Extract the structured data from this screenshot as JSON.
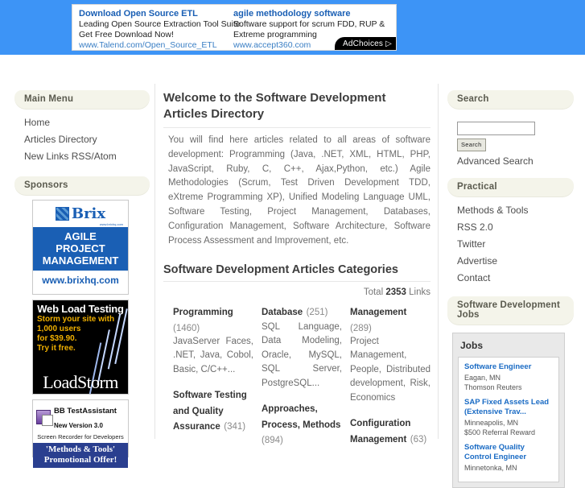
{
  "top_ad": {
    "left": {
      "title": "Download Open Source ETL",
      "line1": "Leading Open Source Extraction Tool Suite.",
      "line2": "Get Free Download Now!",
      "url": "www.Talend.com/Open_Source_ETL"
    },
    "right": {
      "title": "agile methodology software",
      "line1": "Software support for scrum FDD, RUP &",
      "line2": "Extreme programming",
      "url": "www.accept360.com"
    },
    "adchoices_label": "AdChoices"
  },
  "left_sidebar": {
    "main_menu": {
      "caption": "Main Menu",
      "items": [
        {
          "label": "Home"
        },
        {
          "label": "Articles Directory"
        },
        {
          "label": "New Links RSS/Atom"
        }
      ]
    },
    "sponsors": {
      "caption": "Sponsors",
      "banners": [
        {
          "name": "brix",
          "brand": "Brix",
          "site_small": "www.brixhq.com",
          "headline_line1": "AGILE",
          "headline_line2": "PROJECT",
          "headline_line3": "MANAGEMENT",
          "url": "www.brixhq.com"
        },
        {
          "name": "loadstorm",
          "title": "Web Load Testing",
          "line1": "Storm your site with",
          "line2": "1,000 users",
          "line3": "for $39.90.",
          "line4": "Try it free.",
          "logo": "LoadStorm"
        },
        {
          "name": "bb-testassistant",
          "title": "BB TestAssistant",
          "subtitle": "New Version 3.0",
          "tagline": "Screen Recorder for Developers",
          "promo_line1": "'Methods & Tools'",
          "promo_line2": "Promotional Offer!"
        }
      ]
    }
  },
  "main": {
    "page_title": "Welcome to the Software Development Articles Directory",
    "intro": "You will find here articles related to all areas of software development: Programming (Java, .NET, XML, HTML, PHP, JavaScript, Ruby, C, C++, Ajax,Python, etc.) Agile Methodologies (Scrum, Test Driven Development TDD, eXtreme Programming XP), Unified Modeling Language UML, Software Testing, Project Management, Databases, Configuration Management, Software Architecture, Software Process Assessment and Improvement, etc.",
    "categories_title": "Software Development Articles Categories",
    "total_prefix": "Total",
    "total_count": "2353",
    "total_suffix": "Links",
    "columns": [
      [
        {
          "name": "Programming",
          "count": "(1460)",
          "desc": "JavaServer Faces, .NET, Java, Cobol, Basic, C/C++..."
        },
        {
          "name": "Software Testing and Quality Assurance",
          "count": "(341)",
          "desc": ""
        }
      ],
      [
        {
          "name": "Database",
          "count": "(251)",
          "desc": "SQL Language, Data Modeling, Oracle, MySQL, SQL Server, PostgreSQL..."
        },
        {
          "name": "Approaches, Process, Methods",
          "count": "(894)",
          "desc": ""
        }
      ],
      [
        {
          "name": "Management",
          "count": "(289)",
          "desc": "Project Management, People, Distributed development, Risk, Economics"
        },
        {
          "name": "Configuration Management",
          "count": "(63)",
          "desc": ""
        }
      ]
    ]
  },
  "right_sidebar": {
    "search": {
      "caption": "Search",
      "input_value": "",
      "input_placeholder": "",
      "button_label": "Search",
      "advanced_label": "Advanced Search"
    },
    "practical": {
      "caption": "Practical",
      "items": [
        {
          "label": "Methods & Tools"
        },
        {
          "label": "RSS 2.0"
        },
        {
          "label": "Twitter"
        },
        {
          "label": "Advertise"
        },
        {
          "label": "Contact"
        }
      ]
    },
    "jobs": {
      "caption": "Software Development Jobs",
      "widget_title": "Jobs",
      "listings": [
        {
          "title": "Software Engineer",
          "location": "Eagan, MN",
          "company": "Thomson Reuters"
        },
        {
          "title": "SAP Fixed Assets Lead (Extensive Trav...",
          "location": "Minneapolis, MN",
          "company": "$500 Referral Reward"
        },
        {
          "title": "Software Quality Control Engineer",
          "location": "Minnetonka, MN",
          "company": ""
        }
      ]
    }
  },
  "colors": {
    "header_blue": "#3d94f6",
    "link_blue": "#1a6bc4",
    "caption_bg": "#f4f4ea",
    "text_gray": "#6b6b6b"
  }
}
